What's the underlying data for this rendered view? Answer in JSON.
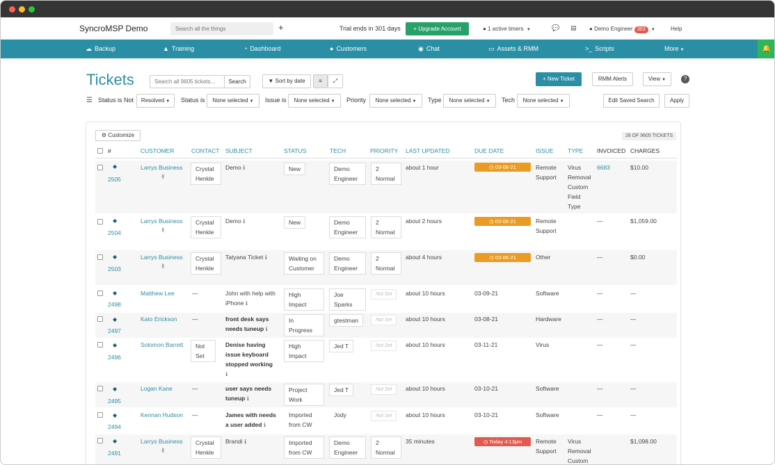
{
  "app": {
    "brand": "SyncroMSP Demo",
    "search_placeholder": "Search all the things",
    "trial_text": "Trial ends in 301 days",
    "upgrade_label": "+ Upgrade Account",
    "timers_label": "1 active timers",
    "engineer_label": "Demo Engineer",
    "engineer_badge": "303",
    "help_label": "Help"
  },
  "nav": {
    "items": [
      {
        "label": "Backup",
        "icon": "cloud-icon"
      },
      {
        "label": "Training",
        "icon": "graduation-cap-icon"
      },
      {
        "label": "Dashboard",
        "icon": "dashboard-icon"
      },
      {
        "label": "Customers",
        "icon": "users-icon"
      },
      {
        "label": "Chat",
        "icon": "chat-icon"
      },
      {
        "label": "Assets & RMM",
        "icon": "monitor-icon"
      },
      {
        "label": "Scripts",
        "icon": "terminal-icon"
      },
      {
        "label": "More",
        "icon": "caret-down-icon"
      }
    ]
  },
  "toolbar": {
    "title": "Tickets",
    "search_placeholder": "Search all 9605 tickets...",
    "search_button": "Search",
    "sort_label": "Sort by date",
    "new_ticket": "+ New Ticket",
    "rmm_alerts": "RMM Alerts",
    "view_label": "View"
  },
  "filters": {
    "status_not_label": "Status is Not",
    "status_not_value": "Resolved",
    "status_label": "Status is",
    "status_value": "None selected",
    "issue_label": "Issue is",
    "issue_value": "None selected",
    "priority_label": "Priority",
    "priority_value": "None selected",
    "type_label": "Type",
    "type_value": "None selected",
    "tech_label": "Tech",
    "tech_value": "None selected",
    "edit_saved": "Edit Saved Search",
    "apply": "Apply"
  },
  "table": {
    "customize": "Customize",
    "count": "28 OF 9605 TICKETS",
    "headers": {
      "num": "#",
      "customer": "CUSTOMER",
      "contact": "CONTACT",
      "subject": "SUBJECT",
      "status": "STATUS",
      "tech": "TECH",
      "priority": "PRIORITY",
      "last_updated": "LAST UPDATED",
      "due_date": "DUE DATE",
      "issue": "ISSUE",
      "type": "TYPE",
      "invoiced": "INVOICED",
      "charges": "CHARGES"
    },
    "rows": [
      {
        "num": "2505",
        "customer": "Larrys Business",
        "contact1": "Crystal",
        "contact2": "Henkle",
        "subject": "Demo",
        "status1": "New",
        "status2": "",
        "tech1": "Demo",
        "tech2": "Engineer",
        "priority1": "2",
        "priority2": "Normal",
        "updated": "about 1 hour",
        "due": "03-06-21",
        "issue1": "Remote",
        "issue2": "Support",
        "type": "Virus Removal Custom Field Type",
        "invoiced": "6683",
        "charges": "$10.00"
      },
      {
        "num": "2504",
        "customer": "Larrys Business",
        "contact1": "Crystal",
        "contact2": "Henkle",
        "subject": "Demo",
        "status1": "New",
        "status2": "",
        "tech1": "Demo",
        "tech2": "Engineer",
        "priority1": "2",
        "priority2": "Normal",
        "updated": "about 2 hours",
        "due": "03-06-21",
        "issue1": "Remote",
        "issue2": "Support",
        "type": "—",
        "invoiced": "",
        "charges": "$1,059.00"
      },
      {
        "num": "2503",
        "customer": "Larrys Business",
        "contact1": "Crystal",
        "contact2": "Henkle",
        "subject": "Tatyana Ticket",
        "status1": "Waiting on",
        "status2": "Customer",
        "tech1": "Demo",
        "tech2": "Engineer",
        "priority1": "2",
        "priority2": "Normal",
        "updated": "about 4 hours",
        "due": "03-06-21",
        "issue1": "Other",
        "issue2": "",
        "type": "—",
        "invoiced": "",
        "charges": "$0.00"
      },
      {
        "num": "2498",
        "customer": "Matthew Lee",
        "contact1": "—",
        "subject1": "John with help with",
        "subject2": "iPhone",
        "status1": "High",
        "status2": "Impact",
        "tech1": "Joe",
        "tech2": "Sparks",
        "priority": "Not Set",
        "updated": "about 10 hours",
        "due": "03-09-21",
        "issue1": "Software",
        "type": "—",
        "invoiced": "—"
      },
      {
        "num": "2497",
        "customer": "Kato Erickson",
        "contact1": "—",
        "subject1": "front desk says",
        "subject2": "needs tuneup",
        "status1": "In",
        "status2": "Progress",
        "tech1": "gtestman",
        "priority": "Not Set",
        "updated": "about 10 hours",
        "due": "03-08-21",
        "issue1": "Hardware",
        "type": "—",
        "invoiced": "—"
      },
      {
        "num": "2496",
        "customer": "Solomon Barrett",
        "contact1": "Not",
        "contact2": "Set",
        "subject1": "Denise having",
        "subject2": "issue keyboard",
        "subject3": "stopped working",
        "status1": "High",
        "status2": "Impact",
        "tech1": "Jed T",
        "priority": "Not Set",
        "updated": "about 10 hours",
        "due": "03-11-21",
        "issue1": "Virus",
        "type": "—",
        "invoiced": "—"
      },
      {
        "num": "2495",
        "customer": "Logan Kane",
        "contact1": "—",
        "subject1": "user says needs",
        "subject2": "tuneup",
        "status1": "Project",
        "status2": "Work",
        "tech1": "Jed T",
        "priority": "Not Set",
        "updated": "about 10 hours",
        "due": "03-10-21",
        "issue1": "Software",
        "type": "—",
        "invoiced": "—"
      },
      {
        "num": "2494",
        "customer": "Kennan Hudson",
        "contact1": "—",
        "subject1": "James with needs",
        "subject2": "a user added",
        "status1": "Imported",
        "status2": "from CW",
        "tech1": "Jody",
        "priority": "Not Set",
        "updated": "about 10 hours",
        "due": "03-10-21",
        "issue1": "Software",
        "type": "—",
        "invoiced": "—"
      },
      {
        "num": "2491",
        "customer": "Larrys Business",
        "contact1": "Crystal",
        "contact2": "Henkle",
        "subject": "Brandi",
        "status1": "Imported",
        "status2": "from CW",
        "tech1": "Demo",
        "tech2": "Engineer",
        "priority1": "2",
        "priority2": "Normal",
        "updated": "35 minutes",
        "due": "Today 4:13pm",
        "issue1": "Remote",
        "issue2": "Support",
        "type": "Virus Removal Custom",
        "invoiced": "",
        "charges": "$1,098.00"
      }
    ]
  },
  "colors": {
    "accent": "#2a8fa5",
    "upgrade": "#26a269",
    "due_orange": "#ea9b23",
    "due_red": "#e05a4f"
  }
}
